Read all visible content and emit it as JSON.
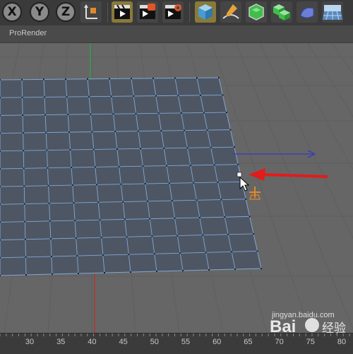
{
  "toolbar": {
    "axis_x": "X",
    "axis_y": "Y",
    "axis_z": "Z",
    "tools": [
      {
        "icon": "world-coordinates-icon"
      },
      {
        "icon": "render-view-icon"
      },
      {
        "icon": "render-picture-viewer-icon"
      },
      {
        "icon": "render-settings-icon"
      },
      {
        "icon": "cube-object-icon"
      },
      {
        "icon": "pen-spline-icon"
      },
      {
        "icon": "subdivision-surface-icon"
      },
      {
        "icon": "array-generator-icon"
      },
      {
        "icon": "deformer-icon"
      },
      {
        "icon": "floor-environment-icon"
      }
    ]
  },
  "view": {
    "label": "ProRender"
  },
  "ruler": {
    "ticks": [
      "30",
      "35",
      "40",
      "45",
      "50",
      "55",
      "60",
      "65",
      "70",
      "75",
      "80"
    ]
  },
  "watermark": {
    "logo": "Bai du 经验",
    "url": "jingyan.baidu.com"
  },
  "colors": {
    "grid_line": "#7fa8d8",
    "plane_fill": "#4e5663",
    "annotation_arrow": "#e31b1b",
    "axis_x": "#3a3ab8",
    "axis_y": "#2ea84a",
    "axis_z": "#b8322e"
  }
}
